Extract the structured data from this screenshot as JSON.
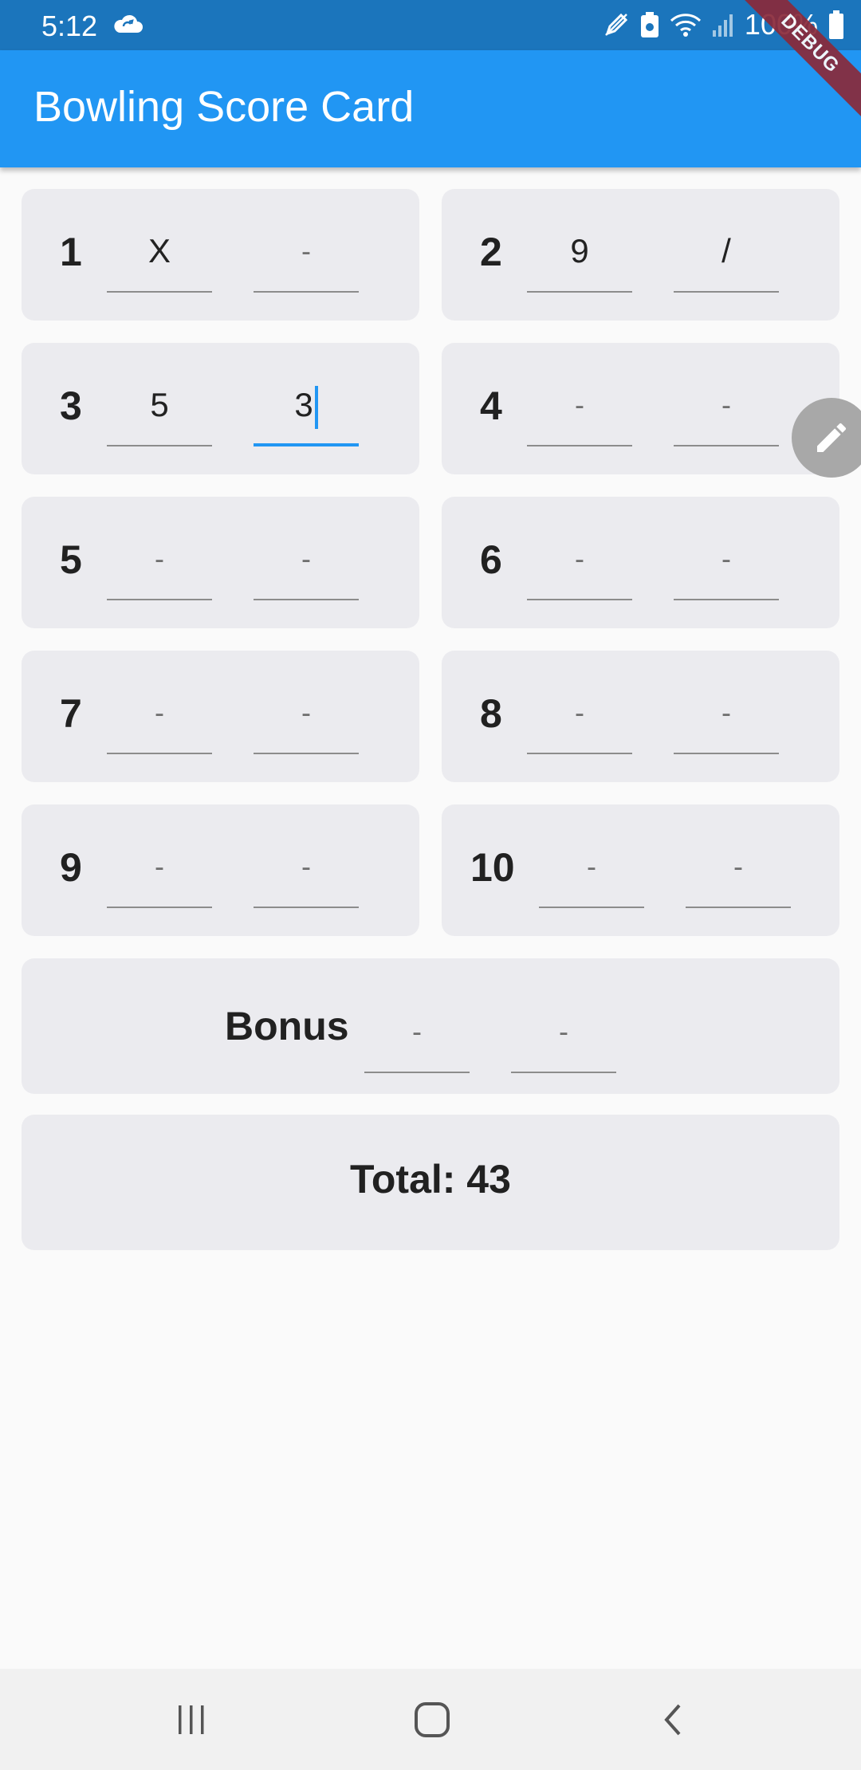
{
  "status_bar": {
    "time": "5:12",
    "battery": "100%",
    "icons": [
      "cloud-sync-icon",
      "edit-icon",
      "battery-saver-icon",
      "wifi-icon",
      "signal-icon",
      "battery-icon"
    ]
  },
  "app_bar": {
    "title": "Bowling Score Card"
  },
  "debug_banner": "DEBUG",
  "frames": [
    {
      "number": "1",
      "roll1": "X",
      "roll2": "-"
    },
    {
      "number": "2",
      "roll1": "9",
      "roll2": "/"
    },
    {
      "number": "3",
      "roll1": "5",
      "roll2": "3"
    },
    {
      "number": "4",
      "roll1": "-",
      "roll2": "-"
    },
    {
      "number": "5",
      "roll1": "-",
      "roll2": "-"
    },
    {
      "number": "6",
      "roll1": "-",
      "roll2": "-"
    },
    {
      "number": "7",
      "roll1": "-",
      "roll2": "-"
    },
    {
      "number": "8",
      "roll1": "-",
      "roll2": "-"
    },
    {
      "number": "9",
      "roll1": "-",
      "roll2": "-"
    },
    {
      "number": "10",
      "roll1": "-",
      "roll2": "-"
    }
  ],
  "bonus": {
    "label": "Bonus",
    "roll1": "-",
    "roll2": "-"
  },
  "total": {
    "label": "Total: 43"
  },
  "colors": {
    "primary": "#2196f3",
    "status_bar": "#1b75bc",
    "card": "#ebebef",
    "debug": "#8a2a3a"
  },
  "fab": {
    "icon": "pencil-icon"
  },
  "nav_bar": {
    "icons": [
      "recent-apps-icon",
      "home-icon",
      "back-icon"
    ]
  }
}
